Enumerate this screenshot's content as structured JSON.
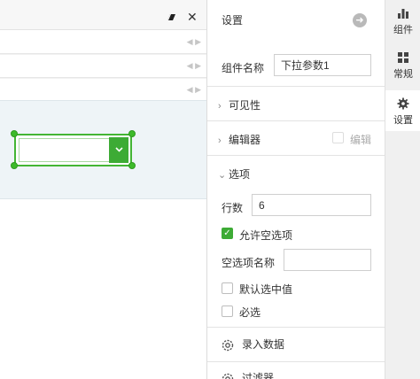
{
  "canvas": {
    "close_label": "✕",
    "param_rows": [
      {},
      {},
      {}
    ],
    "row_arrows": "◀ ▶"
  },
  "panel": {
    "title": "设置",
    "component_name_label": "组件名称",
    "component_name_value": "下拉参数1",
    "sections": {
      "visibility": "可见性",
      "editor": "编辑器",
      "editor_checkbox_label": "编辑",
      "options": "选项"
    },
    "rows_label": "行数",
    "rows_value": "6",
    "allow_empty_label": "允许空选项",
    "empty_name_label": "空选项名称",
    "empty_name_value": "",
    "default_selected_label": "默认选中值",
    "required_label": "必选",
    "enter_data_label": "录入数据",
    "filter_label": "过滤器"
  },
  "tabs": [
    {
      "label": "组件",
      "icon": "bar-chart-icon"
    },
    {
      "label": "常规",
      "icon": "grid-icon"
    },
    {
      "label": "设置",
      "icon": "gear-icon"
    }
  ],
  "colors": {
    "accent_green": "#3dab35",
    "canvas_bg": "#eef4f7"
  }
}
